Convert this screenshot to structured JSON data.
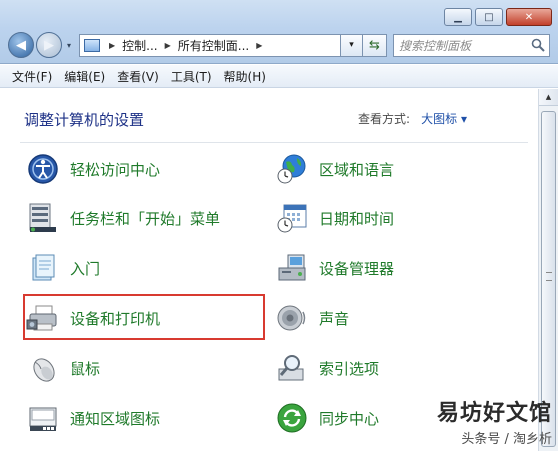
{
  "window": {
    "minimize": "▁",
    "maximize": "□",
    "close": "✕"
  },
  "nav": {
    "back": "◀",
    "forward": "▶",
    "dropdown": "▾"
  },
  "address": {
    "crumbs": [
      "控制...",
      "所有控制面..."
    ],
    "sep": "▶"
  },
  "search": {
    "placeholder": "搜索控制面板"
  },
  "menu": [
    "文件(F)",
    "编辑(E)",
    "查看(V)",
    "工具(T)",
    "帮助(H)"
  ],
  "content": {
    "heading": "调整计算机的设置",
    "view_by_label": "查看方式:",
    "view_by_value": "大图标 ▾",
    "left_items": [
      "轻松访问中心",
      "任务栏和「开始」菜单",
      "入门",
      "设备和打印机",
      "鼠标",
      "通知区域图标"
    ],
    "right_items": [
      "区域和语言",
      "日期和时间",
      "设备管理器",
      "声音",
      "索引选项",
      "同步中心"
    ],
    "highlighted_item": "设备和打印机"
  },
  "watermark": {
    "line1": "易坊好文馆",
    "line2": "头条号 / 淘乡析"
  },
  "colors": {
    "link_green": "#1f7a2a",
    "heading_blue": "#1e3287",
    "highlight_red": "#d83a30"
  }
}
